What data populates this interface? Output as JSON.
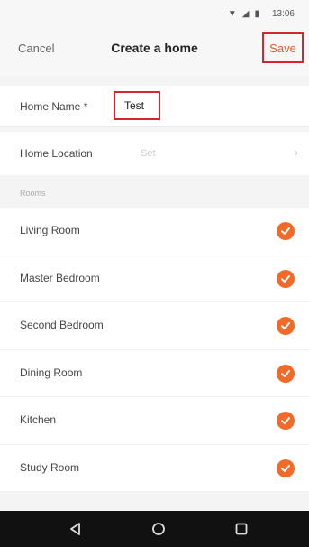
{
  "status_bar": {
    "icons": [
      "wifi-icon",
      "signal-icon",
      "battery-icon"
    ],
    "time": "13:06"
  },
  "header": {
    "cancel_label": "Cancel",
    "title": "Create a home",
    "save_label": "Save"
  },
  "form": {
    "home_name_label": "Home Name *",
    "home_name_value": "Test",
    "home_location_label": "Home Location",
    "home_location_value": "Set"
  },
  "rooms": {
    "section_label": "Rooms",
    "items": [
      {
        "label": "Living Room",
        "checked": true
      },
      {
        "label": "Master Bedroom",
        "checked": true
      },
      {
        "label": "Second Bedroom",
        "checked": true
      },
      {
        "label": "Dining Room",
        "checked": true
      },
      {
        "label": "Kitchen",
        "checked": true
      },
      {
        "label": "Study Room",
        "checked": true
      }
    ]
  },
  "colors": {
    "accent": "#f06a2a",
    "highlight_border": "#d9232e"
  },
  "android_nav": [
    "back-icon",
    "home-icon",
    "recent-apps-icon"
  ]
}
